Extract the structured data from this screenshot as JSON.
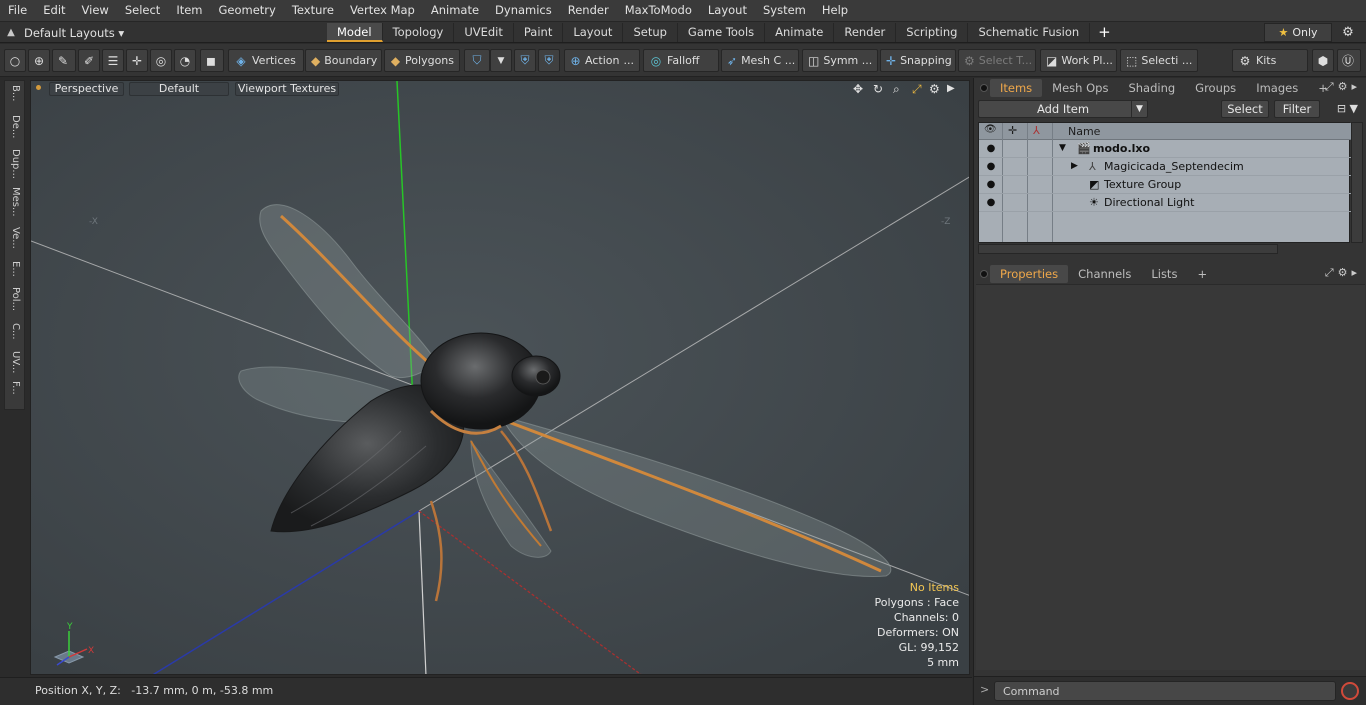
{
  "menu": [
    "File",
    "Edit",
    "View",
    "Select",
    "Item",
    "Geometry",
    "Texture",
    "Vertex Map",
    "Animate",
    "Dynamics",
    "Render",
    "MaxToModo",
    "Layout",
    "System",
    "Help"
  ],
  "layouts": {
    "label": "Default Layouts ▾"
  },
  "tabs": [
    {
      "label": "Model",
      "active": true
    },
    {
      "label": "Topology"
    },
    {
      "label": "UVEdit"
    },
    {
      "label": "Paint"
    },
    {
      "label": "Layout"
    },
    {
      "label": "Setup"
    },
    {
      "label": "Game Tools"
    },
    {
      "label": "Animate"
    },
    {
      "label": "Render"
    },
    {
      "label": "Scripting"
    },
    {
      "label": "Schematic Fusion"
    }
  ],
  "tab_plus": "+",
  "only_label": "Only",
  "toolbar": {
    "vertices": "Vertices",
    "boundary": "Boundary",
    "polygons": "Polygons",
    "action": "Action",
    "action_more": "...",
    "falloff": "Falloff",
    "mesh": "Mesh C ...",
    "symm": "Symm ...",
    "snapping": "Snapping",
    "select_t": "Select T...",
    "workpl": "Work Pl...",
    "selecti": "Selecti ...",
    "kits": "Kits"
  },
  "left_tabs": [
    "B...",
    "De...",
    "Dup...",
    "Mes...",
    "Ve...",
    "E...",
    "Pol...",
    "C...",
    "UV...",
    "F..."
  ],
  "viewport": {
    "perspective": "Perspective",
    "default": "Default",
    "viewport_textures": "Viewport Textures",
    "neg_x": "-X",
    "neg_z": "-Z",
    "hud": {
      "no_items": "No Items",
      "polygons": "Polygons : Face",
      "channels": "Channels: 0",
      "deformers": "Deformers: ON",
      "gl": "GL: 99,152",
      "scale": "5 mm"
    },
    "gizmo": {
      "x": "X",
      "y": "Y"
    }
  },
  "status": {
    "position": "Position X, Y, Z:   -13.7 mm, 0 m, -53.8 mm"
  },
  "items_panel": {
    "tabs": [
      "Items",
      "Mesh Ops",
      "Shading",
      "Groups",
      "Images"
    ],
    "add_item": "Add Item",
    "select": "Select",
    "filter": "Filter",
    "name_header": "Name",
    "rows": [
      {
        "name": "modo.lxo",
        "bold": true
      },
      {
        "name": "Magicicada_Septendecim"
      },
      {
        "name": "Texture Group"
      },
      {
        "name": "Directional Light"
      }
    ]
  },
  "props_panel": {
    "tabs": [
      "Properties",
      "Channels",
      "Lists"
    ]
  },
  "panel_plus": "+",
  "command": {
    "placeholder": "Command"
  }
}
